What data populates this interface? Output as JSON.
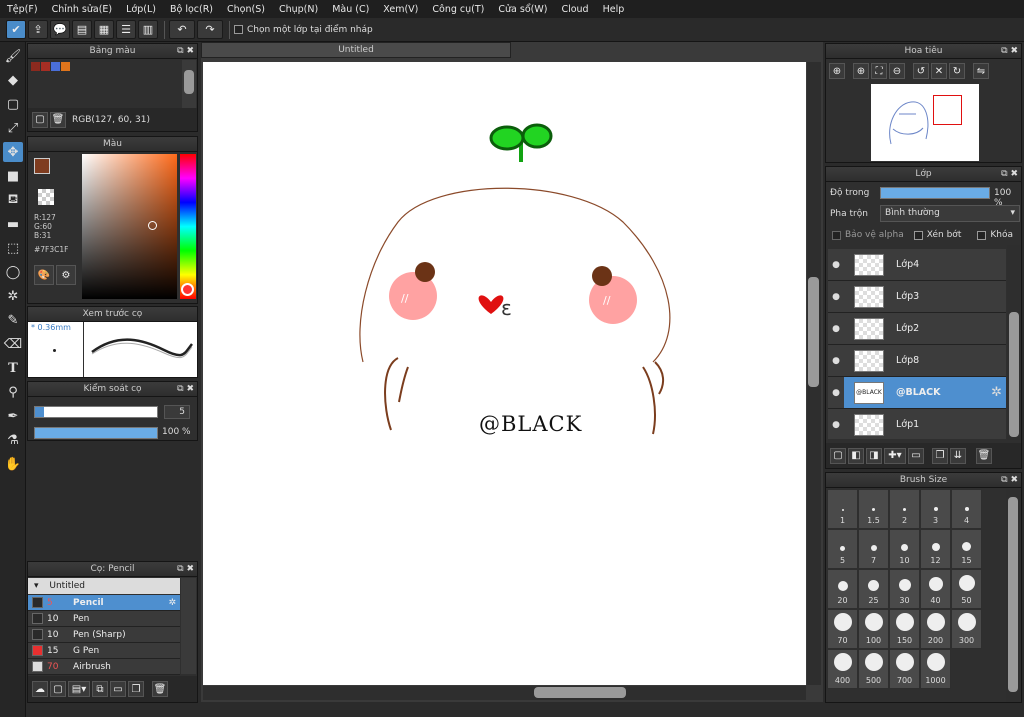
{
  "menu": [
    "Tệp(F)",
    "Chỉnh sửa(E)",
    "Lớp(L)",
    "Bộ lọc(R)",
    "Chọn(S)",
    "Chụp(N)",
    "Màu (C)",
    "Xem(V)",
    "Công cụ(T)",
    "Cửa sổ(W)",
    "Cloud",
    "Help"
  ],
  "toolbar": {
    "checkbox_label": "Chọn một lớp tại điểm nháp"
  },
  "palette": {
    "title": "Bảng màu",
    "swatches": [
      "#8b2a1f",
      "#a62e24",
      "#4a6fd8",
      "#e0751c"
    ],
    "rgb_text": "RGB(127, 60, 31)"
  },
  "color": {
    "title": "Màu",
    "r": "R:127",
    "g": "G:60",
    "b": "B:31",
    "hex": "#7F3C1F",
    "main_color": "#7f3c1f"
  },
  "brush_preview": {
    "title": "Xem trước cọ",
    "size": "* 0.36mm"
  },
  "brush_control": {
    "title": "Kiểm soát cọ",
    "size_value": "5",
    "opacity_value": "100 %",
    "size_fraction": 0.07,
    "opacity_fraction": 1.0
  },
  "brush_list": {
    "title": "Cọ: Pencil",
    "group": "Untitled",
    "items": [
      {
        "size": "5",
        "name": "Pencil",
        "color": "#2a2a2a",
        "selected": true
      },
      {
        "size": "10",
        "name": "Pen",
        "color": "#2a2a2a",
        "selected": false
      },
      {
        "size": "10",
        "name": "Pen (Sharp)",
        "color": "#2a2a2a",
        "selected": false
      },
      {
        "size": "15",
        "name": "G Pen",
        "color": "#e83030",
        "selected": false
      },
      {
        "size": "70",
        "name": "Airbrush",
        "color": "#dddddd",
        "selected": false
      }
    ]
  },
  "canvas": {
    "tab": "Untitled",
    "watermark": "@BLACK"
  },
  "navigator": {
    "title": "Hoa tiêu"
  },
  "layers": {
    "title": "Lớp",
    "opacity_label": "Độ trong",
    "opacity_value": "100 %",
    "opacity_fraction": 1.0,
    "blend_label": "Pha trộn",
    "blend_value": "Bình thường",
    "protect_alpha": "Bảo vệ alpha",
    "clipping": "Xén bớt",
    "lock": "Khóa",
    "items": [
      {
        "name": "Lớp4",
        "selected": false
      },
      {
        "name": "Lớp3",
        "selected": false
      },
      {
        "name": "Lớp2",
        "selected": false
      },
      {
        "name": "Lớp8",
        "selected": false
      },
      {
        "name": "@BLACK",
        "selected": true,
        "thumb_text": "@BLACK"
      },
      {
        "name": "Lớp1",
        "selected": false
      }
    ]
  },
  "brush_size": {
    "title": "Brush Size",
    "sizes": [
      "1",
      "1.5",
      "2",
      "3",
      "4",
      "5",
      "7",
      "10",
      "12",
      "15",
      "20",
      "25",
      "30",
      "40",
      "50",
      "70",
      "100",
      "150",
      "200",
      "300",
      "400",
      "500",
      "700",
      "1000"
    ]
  }
}
